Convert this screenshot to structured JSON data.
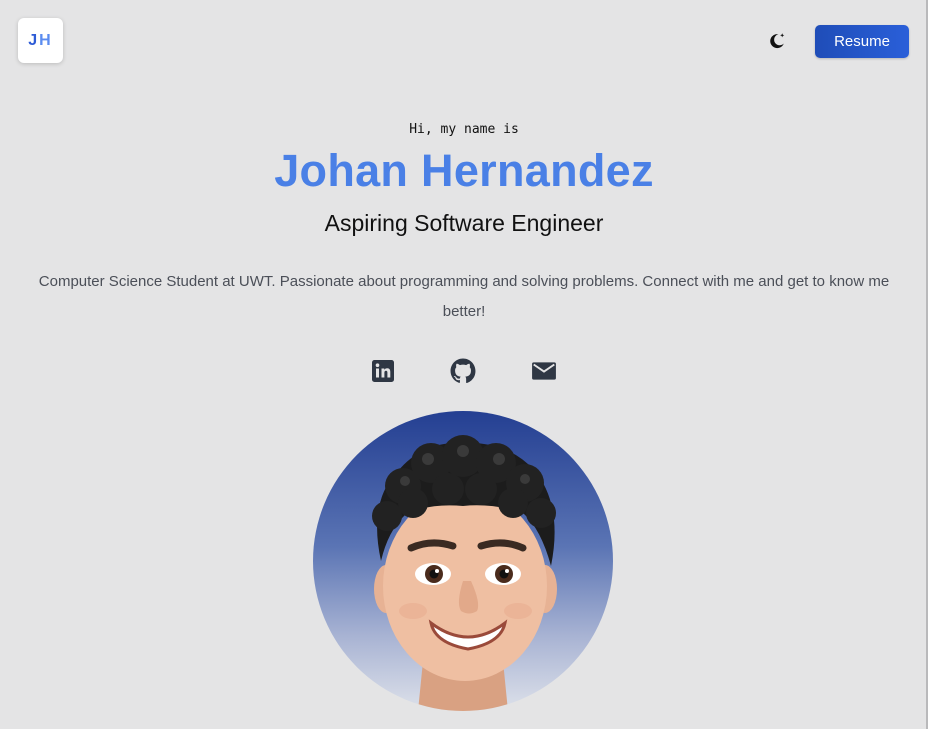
{
  "header": {
    "logo_initial_1": "J",
    "logo_initial_2": "H",
    "theme_toggle_icon": "moon-icon",
    "resume_label": "Resume"
  },
  "hero": {
    "greeting": "Hi, my name is",
    "name": "Johan Hernandez",
    "role": "Aspiring Software Engineer",
    "bio": "Computer Science Student at UWT. Passionate about programming and solving problems. Connect with me and get to know me better!"
  },
  "socials": [
    {
      "icon": "linkedin-icon"
    },
    {
      "icon": "github-icon"
    },
    {
      "icon": "email-icon"
    }
  ],
  "colors": {
    "background": "#e4e4e5",
    "accent": "#4a80e6",
    "button": "#1f4db8",
    "icon": "#2f3744"
  }
}
